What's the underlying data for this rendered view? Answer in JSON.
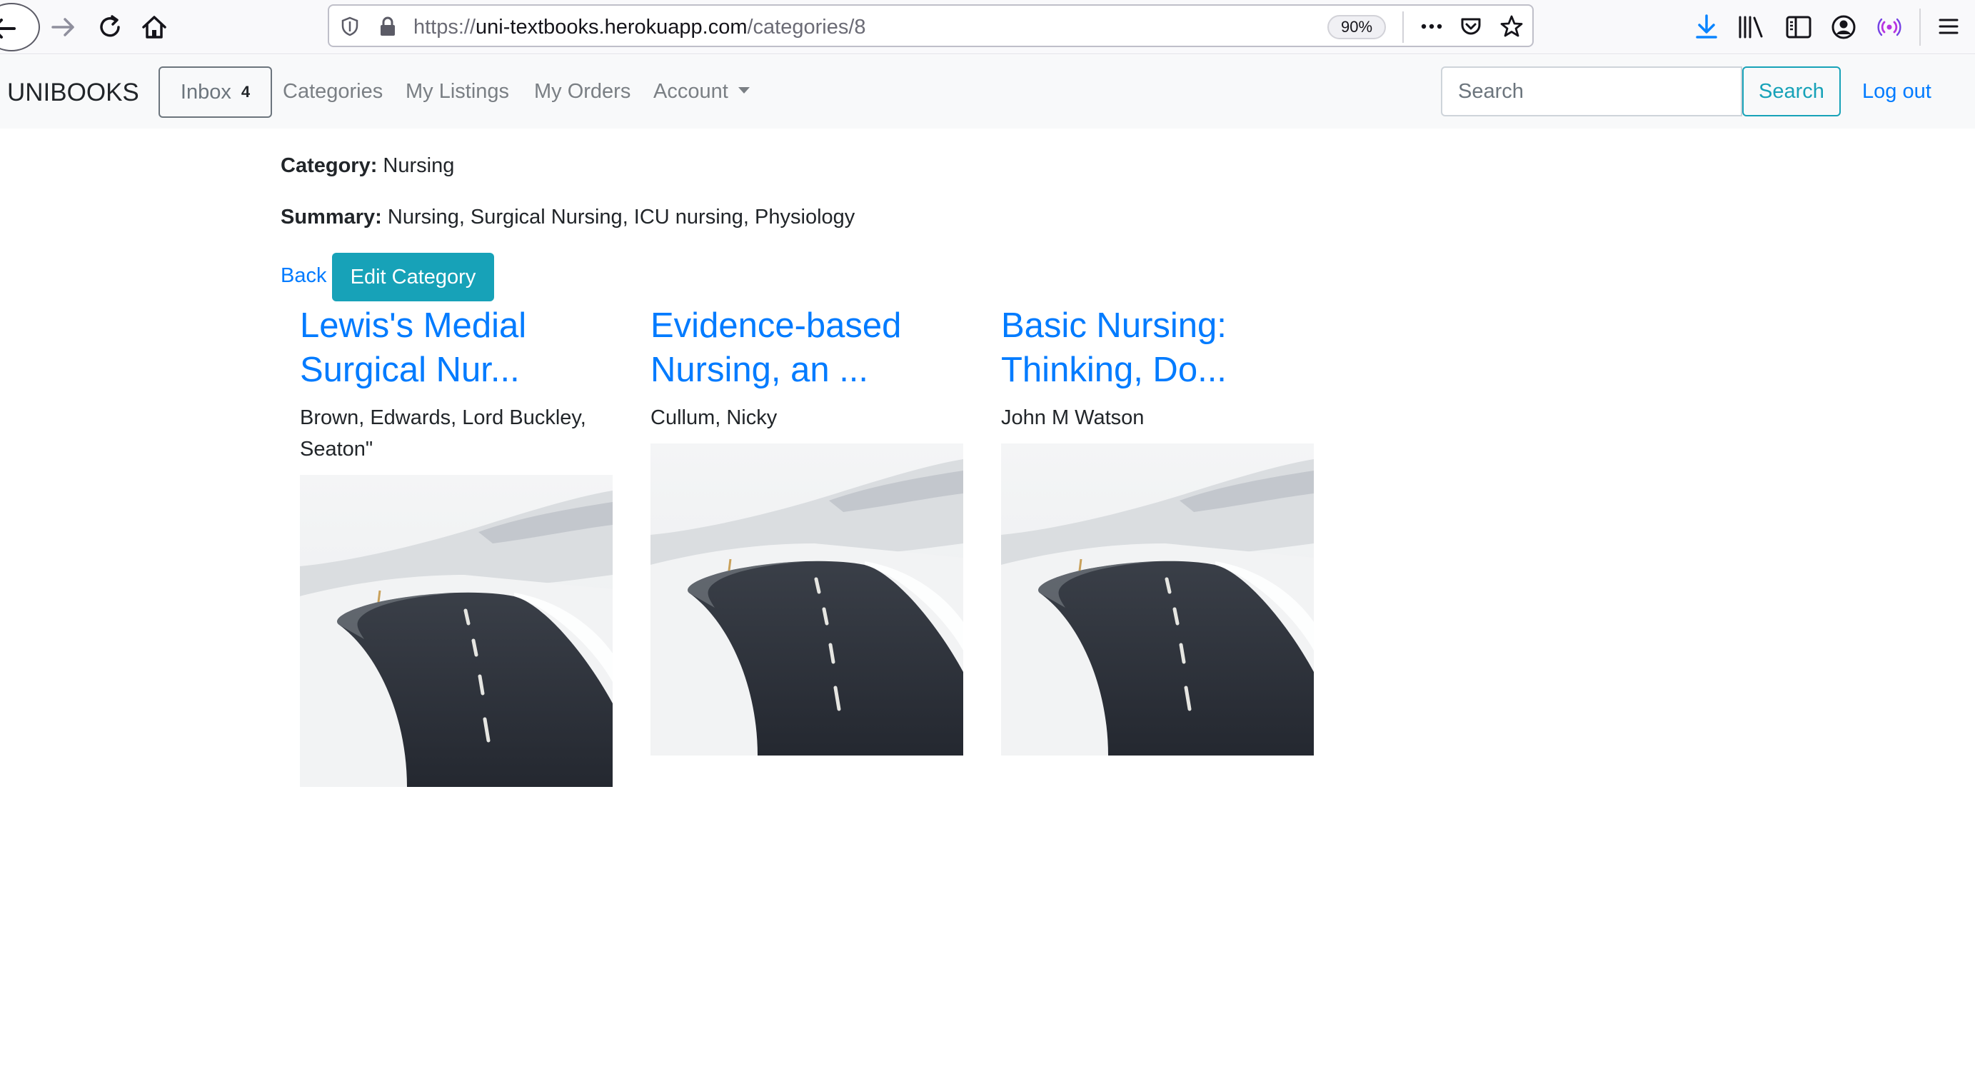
{
  "browser": {
    "url_prefix": "https://",
    "url_host": "uni-textbooks.herokuapp.com",
    "url_path": "/categories/8",
    "zoom": "90%"
  },
  "navbar": {
    "brand": "UNIBOOKS",
    "inbox_label": "Inbox",
    "inbox_count": "4",
    "links": {
      "categories": "Categories",
      "my_listings": "My Listings",
      "my_orders": "My Orders",
      "account": "Account"
    },
    "search_placeholder": "Search",
    "search_button": "Search",
    "logout": "Log out"
  },
  "category": {
    "category_label": "Category:",
    "category_value": "Nursing",
    "summary_label": "Summary:",
    "summary_value": "Nursing, Surgical Nursing, ICU nursing, Physiology",
    "back": "Back",
    "edit_button": "Edit Category"
  },
  "books": [
    {
      "title": "Lewis's Medial Surgical Nur...",
      "author": "Brown, Edwards, Lord Buckley, Seaton\""
    },
    {
      "title": "Evidence-based Nursing, an ...",
      "author": "Cullum, Nicky"
    },
    {
      "title": "Basic Nursing: Thinking, Do...",
      "author": "John M Watson"
    }
  ],
  "colors": {
    "link": "#007bff",
    "info": "#17a2b8",
    "navbar_bg": "#f8f9fa"
  }
}
